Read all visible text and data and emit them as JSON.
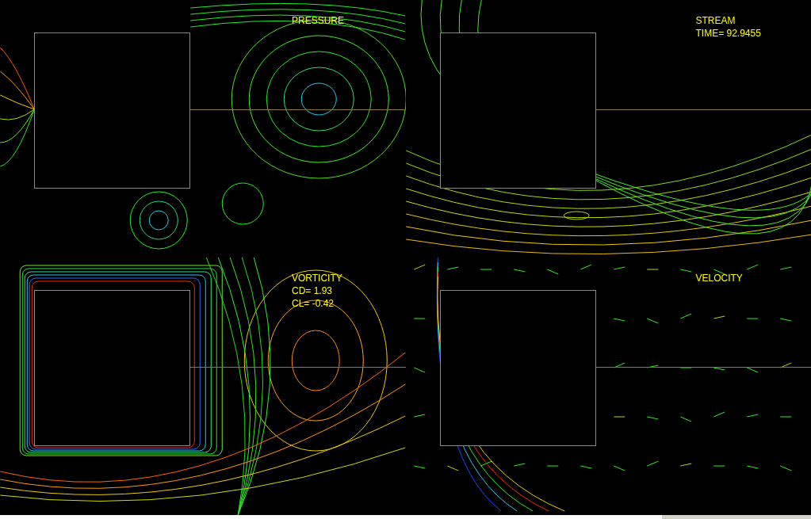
{
  "panels": [
    {
      "kind": "pressure",
      "labels": [
        "PRESSURE"
      ]
    },
    {
      "kind": "stream",
      "labels": [
        "STREAM",
        "TIME= 92.9455"
      ]
    },
    {
      "kind": "vorticity",
      "labels": [
        "VORTICITY",
        "CD= 1.93",
        "CL= -0.42"
      ]
    },
    {
      "kind": "velocity",
      "labels": [
        "VELOCITY"
      ]
    }
  ]
}
